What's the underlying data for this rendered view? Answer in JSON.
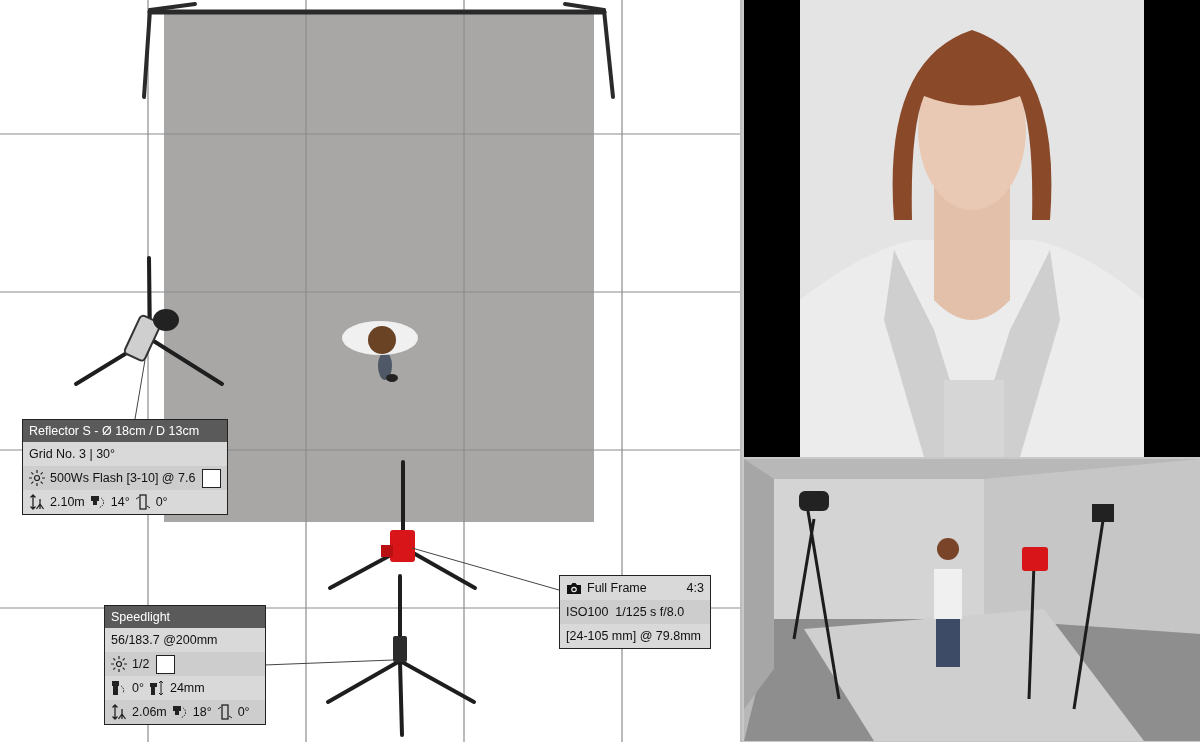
{
  "plan": {
    "lights": [
      {
        "title": "Reflector S - Ø 18cm / D 13cm",
        "rows": [
          {
            "kind": "text",
            "text": "Grid No. 3 | 30°"
          },
          {
            "kind": "power",
            "text": "500Ws Flash [3-10] @ 7.6"
          },
          {
            "kind": "position",
            "height": "2.10m",
            "tilt": "14°",
            "roll": "0°"
          }
        ]
      },
      {
        "title": "Speedlight",
        "rows": [
          {
            "kind": "text",
            "text": "56/183.7 @200mm"
          },
          {
            "kind": "power",
            "text": "1/2"
          },
          {
            "kind": "zoom",
            "angle": "0°",
            "length": "24mm"
          },
          {
            "kind": "position",
            "height": "2.06m",
            "tilt": "18°",
            "roll": "0°"
          }
        ]
      }
    ],
    "camera": {
      "format": "Full Frame",
      "ratio": "4:3",
      "exposure": "ISO100  1/125 s f/8.0",
      "lens": "[24-105 mm] @ 79.8mm"
    }
  }
}
